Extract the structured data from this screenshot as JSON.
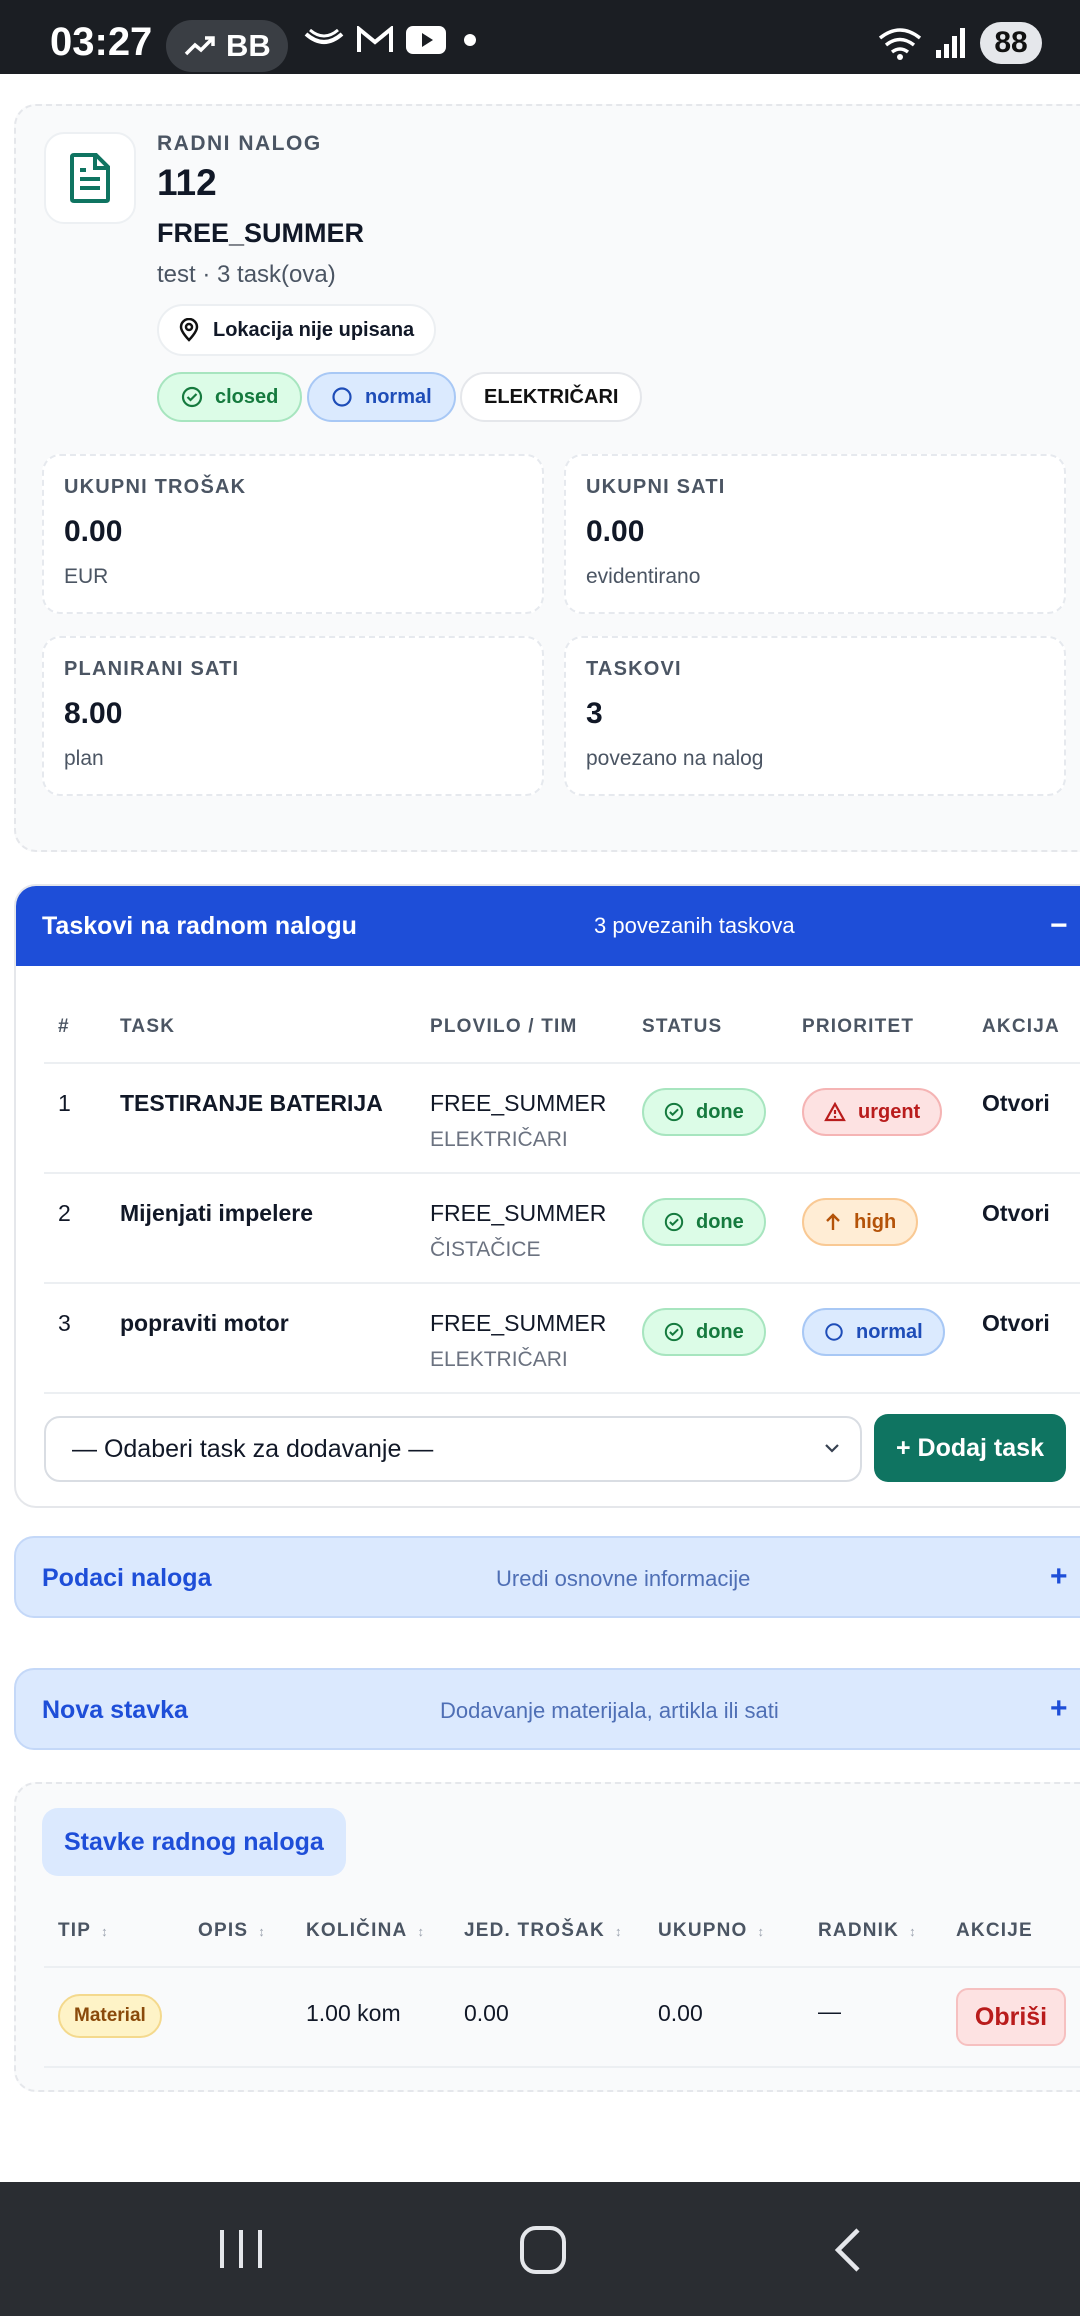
{
  "status_bar": {
    "time": "03:27",
    "pill_text": "BB",
    "battery": "88",
    "icons": [
      "trend-icon",
      "sway-icon",
      "gmail-icon",
      "youtube-icon",
      "dot-icon",
      "wifi-icon",
      "signal-icon"
    ]
  },
  "work_order": {
    "eyebrow": "RADNI NALOG",
    "number": "112",
    "name": "FREE_SUMMER",
    "subtitle": "test · 3 task(ova)",
    "location": "Lokacija nije upisana",
    "status_chip": "closed",
    "priority_chip": "normal",
    "team_chip": "ELEKTRIČARI"
  },
  "stats": [
    {
      "label": "UKUPNI TROŠAK",
      "value": "0.00",
      "sub": "EUR"
    },
    {
      "label": "UKUPNI SATI",
      "value": "0.00",
      "sub": "evidentirano"
    },
    {
      "label": "PLANIRANI SATI",
      "value": "8.00",
      "sub": "plan"
    },
    {
      "label": "TASKOVI",
      "value": "3",
      "sub": "povezano na nalog"
    }
  ],
  "tasks_section": {
    "title": "Taskovi na radnom nalogu",
    "summary": "3 povezanih taskova",
    "toggle": "−",
    "columns": [
      "#",
      "TASK",
      "PLOVILO / TIM",
      "STATUS",
      "PRIORITET",
      "AKCIJA"
    ],
    "rows": [
      {
        "n": "1",
        "task": "TESTIRANJE BATERIJA",
        "vessel": "FREE_SUMMER",
        "team": "ELEKTRIČARI",
        "status": "done",
        "priority": "urgent",
        "action": "Otvori"
      },
      {
        "n": "2",
        "task": "Mijenjati impelere",
        "vessel": "FREE_SUMMER",
        "team": "ČISTAČICE",
        "status": "done",
        "priority": "high",
        "action": "Otvori"
      },
      {
        "n": "3",
        "task": "popraviti motor",
        "vessel": "FREE_SUMMER",
        "team": "ELEKTRIČARI",
        "status": "done",
        "priority": "normal",
        "action": "Otvori"
      }
    ],
    "select_placeholder": "— Odaberi task za dodavanje —",
    "add_button": "+ Dodaj task"
  },
  "order_data_section": {
    "title": "Podaci naloga",
    "subtitle": "Uredi osnovne informacije",
    "toggle": "+"
  },
  "new_item_section": {
    "title": "Nova stavka",
    "subtitle": "Dodavanje materijala, artikla ili sati",
    "toggle": "+"
  },
  "items_section": {
    "title": "Stavke radnog naloga",
    "columns": [
      "TIP",
      "OPIS",
      "KOLIČINA",
      "JED. TROŠAK",
      "UKUPNO",
      "RADNIK",
      "AKCIJE"
    ],
    "sort_glyph": "↕",
    "rows": [
      {
        "type": "Material",
        "description": "",
        "quantity": "1.00 kom",
        "unit_cost": "0.00",
        "total": "0.00",
        "worker": "—",
        "action": "Obriši"
      }
    ]
  },
  "colors": {
    "primary_blue": "#1e4ed8",
    "teal_button": "#0f7461",
    "status_done": "#157a3e",
    "priority_urgent": "#b91c1c",
    "priority_high": "#b45309"
  }
}
